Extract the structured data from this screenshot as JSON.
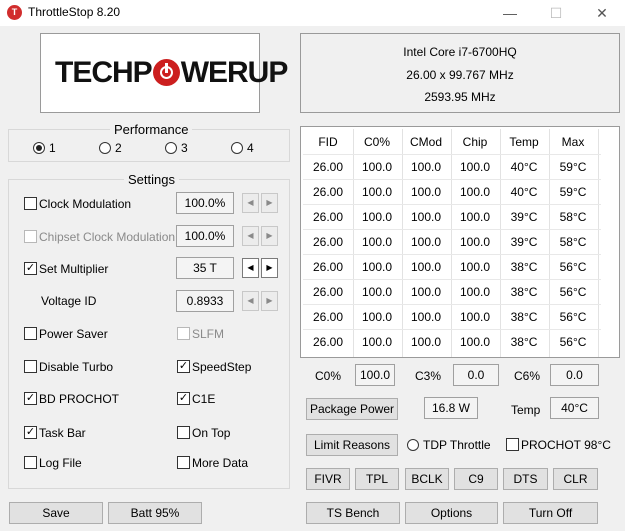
{
  "window": {
    "title": "ThrottleStop 8.20",
    "app_icon_letter": "T",
    "minimize": "—",
    "maximize": "☐",
    "close": "✕"
  },
  "logo": {
    "text_before": "TECHP",
    "text_after": "WERUP"
  },
  "cpu": {
    "name": "Intel Core i7-6700HQ",
    "multiplier": "26.00 x 99.767 MHz",
    "frequency": "2593.95 MHz"
  },
  "performance": {
    "title": "Performance",
    "options": [
      "1",
      "2",
      "3",
      "4"
    ],
    "selected": "1"
  },
  "settings": {
    "title": "Settings",
    "clock_modulation": {
      "label": "Clock Modulation",
      "value": "100.0%",
      "checked": false
    },
    "chipset_clock_modulation": {
      "label": "Chipset Clock Modulation",
      "value": "100.0%",
      "checked": false,
      "enabled": false
    },
    "set_multiplier": {
      "label": "Set Multiplier",
      "value": "35 T",
      "checked": true
    },
    "voltage_id": {
      "label": "Voltage ID",
      "value": "0.8933"
    },
    "power_saver": {
      "label": "Power Saver",
      "checked": false
    },
    "slfm": {
      "label": "SLFM",
      "checked": false,
      "enabled": false
    },
    "disable_turbo": {
      "label": "Disable Turbo",
      "checked": false
    },
    "speedstep": {
      "label": "SpeedStep",
      "checked": true
    },
    "bd_prochot": {
      "label": "BD PROCHOT",
      "checked": true
    },
    "c1e": {
      "label": "C1E",
      "checked": true
    },
    "task_bar": {
      "label": "Task Bar",
      "checked": true
    },
    "on_top": {
      "label": "On Top",
      "checked": false
    },
    "log_file": {
      "label": "Log File",
      "checked": false
    },
    "more_data": {
      "label": "More Data",
      "checked": false
    },
    "spin_left": "◀",
    "spin_right": "▶",
    "check_mark": "✓"
  },
  "bottom_left": {
    "save": "Save",
    "batt": "Batt 95%"
  },
  "table": {
    "headers": [
      "FID",
      "C0%",
      "CMod",
      "Chip",
      "Temp",
      "Max"
    ],
    "rows": [
      [
        "26.00",
        "100.0",
        "100.0",
        "100.0",
        "40°C",
        "59°C"
      ],
      [
        "26.00",
        "100.0",
        "100.0",
        "100.0",
        "40°C",
        "59°C"
      ],
      [
        "26.00",
        "100.0",
        "100.0",
        "100.0",
        "39°C",
        "58°C"
      ],
      [
        "26.00",
        "100.0",
        "100.0",
        "100.0",
        "39°C",
        "58°C"
      ],
      [
        "26.00",
        "100.0",
        "100.0",
        "100.0",
        "38°C",
        "56°C"
      ],
      [
        "26.00",
        "100.0",
        "100.0",
        "100.0",
        "38°C",
        "56°C"
      ],
      [
        "26.00",
        "100.0",
        "100.0",
        "100.0",
        "38°C",
        "56°C"
      ],
      [
        "26.00",
        "100.0",
        "100.0",
        "100.0",
        "38°C",
        "56°C"
      ]
    ]
  },
  "stats": {
    "c0_label": "C0%",
    "c0_value": "100.0",
    "c3_label": "C3%",
    "c3_value": "0.0",
    "c6_label": "C6%",
    "c6_value": "0.0",
    "package_power_label": "Package Power",
    "package_power_value": "16.8 W",
    "temp_label": "Temp",
    "temp_value": "40°C"
  },
  "limit_row": {
    "limit_reasons": "Limit Reasons",
    "tdp_throttle": "TDP Throttle",
    "prochot": "PROCHOT 98°C"
  },
  "tool_buttons": [
    "FIVR",
    "TPL",
    "BCLK",
    "C9",
    "DTS",
    "CLR"
  ],
  "action_buttons": {
    "ts_bench": "TS Bench",
    "options": "Options",
    "turn_off": "Turn Off"
  }
}
